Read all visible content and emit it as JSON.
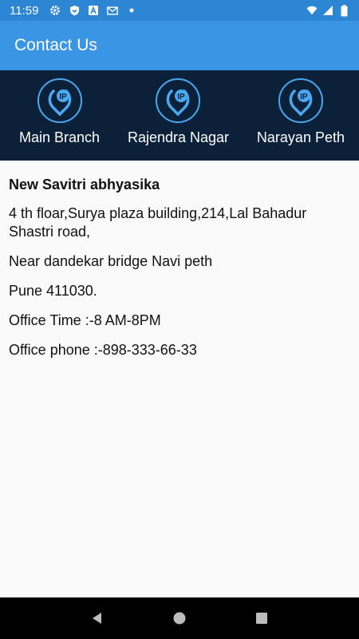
{
  "status_bar": {
    "time": "11:59",
    "icons": [
      "settings-icon",
      "shield-icon",
      "a-badge-icon",
      "mail-icon",
      "dot-icon",
      "wifi-icon",
      "signal-icon",
      "battery-icon"
    ]
  },
  "app_bar": {
    "title": "Contact Us",
    "color": "#3a95e4"
  },
  "branches": [
    {
      "label": "Main Branch",
      "logo_text": "IP"
    },
    {
      "label": "Rajendra Nagar",
      "logo_text": "IP"
    },
    {
      "label": "Narayan Peth",
      "logo_text": "IP"
    }
  ],
  "branch_bar_color": "#0b2039",
  "details": {
    "name": "New Savitri abhyasika",
    "address_line1": "4 th floar,Surya plaza building,214,Lal Bahadur Shastri road,",
    "address_line2": "Near dandekar bridge Navi peth",
    "city": "Pune 411030.",
    "office_time": "Office Time :-8 AM-8PM",
    "office_phone": "Office phone :-898-333-66-33"
  },
  "nav_bar": {
    "buttons": [
      "back-icon",
      "home-icon",
      "recents-icon"
    ]
  }
}
